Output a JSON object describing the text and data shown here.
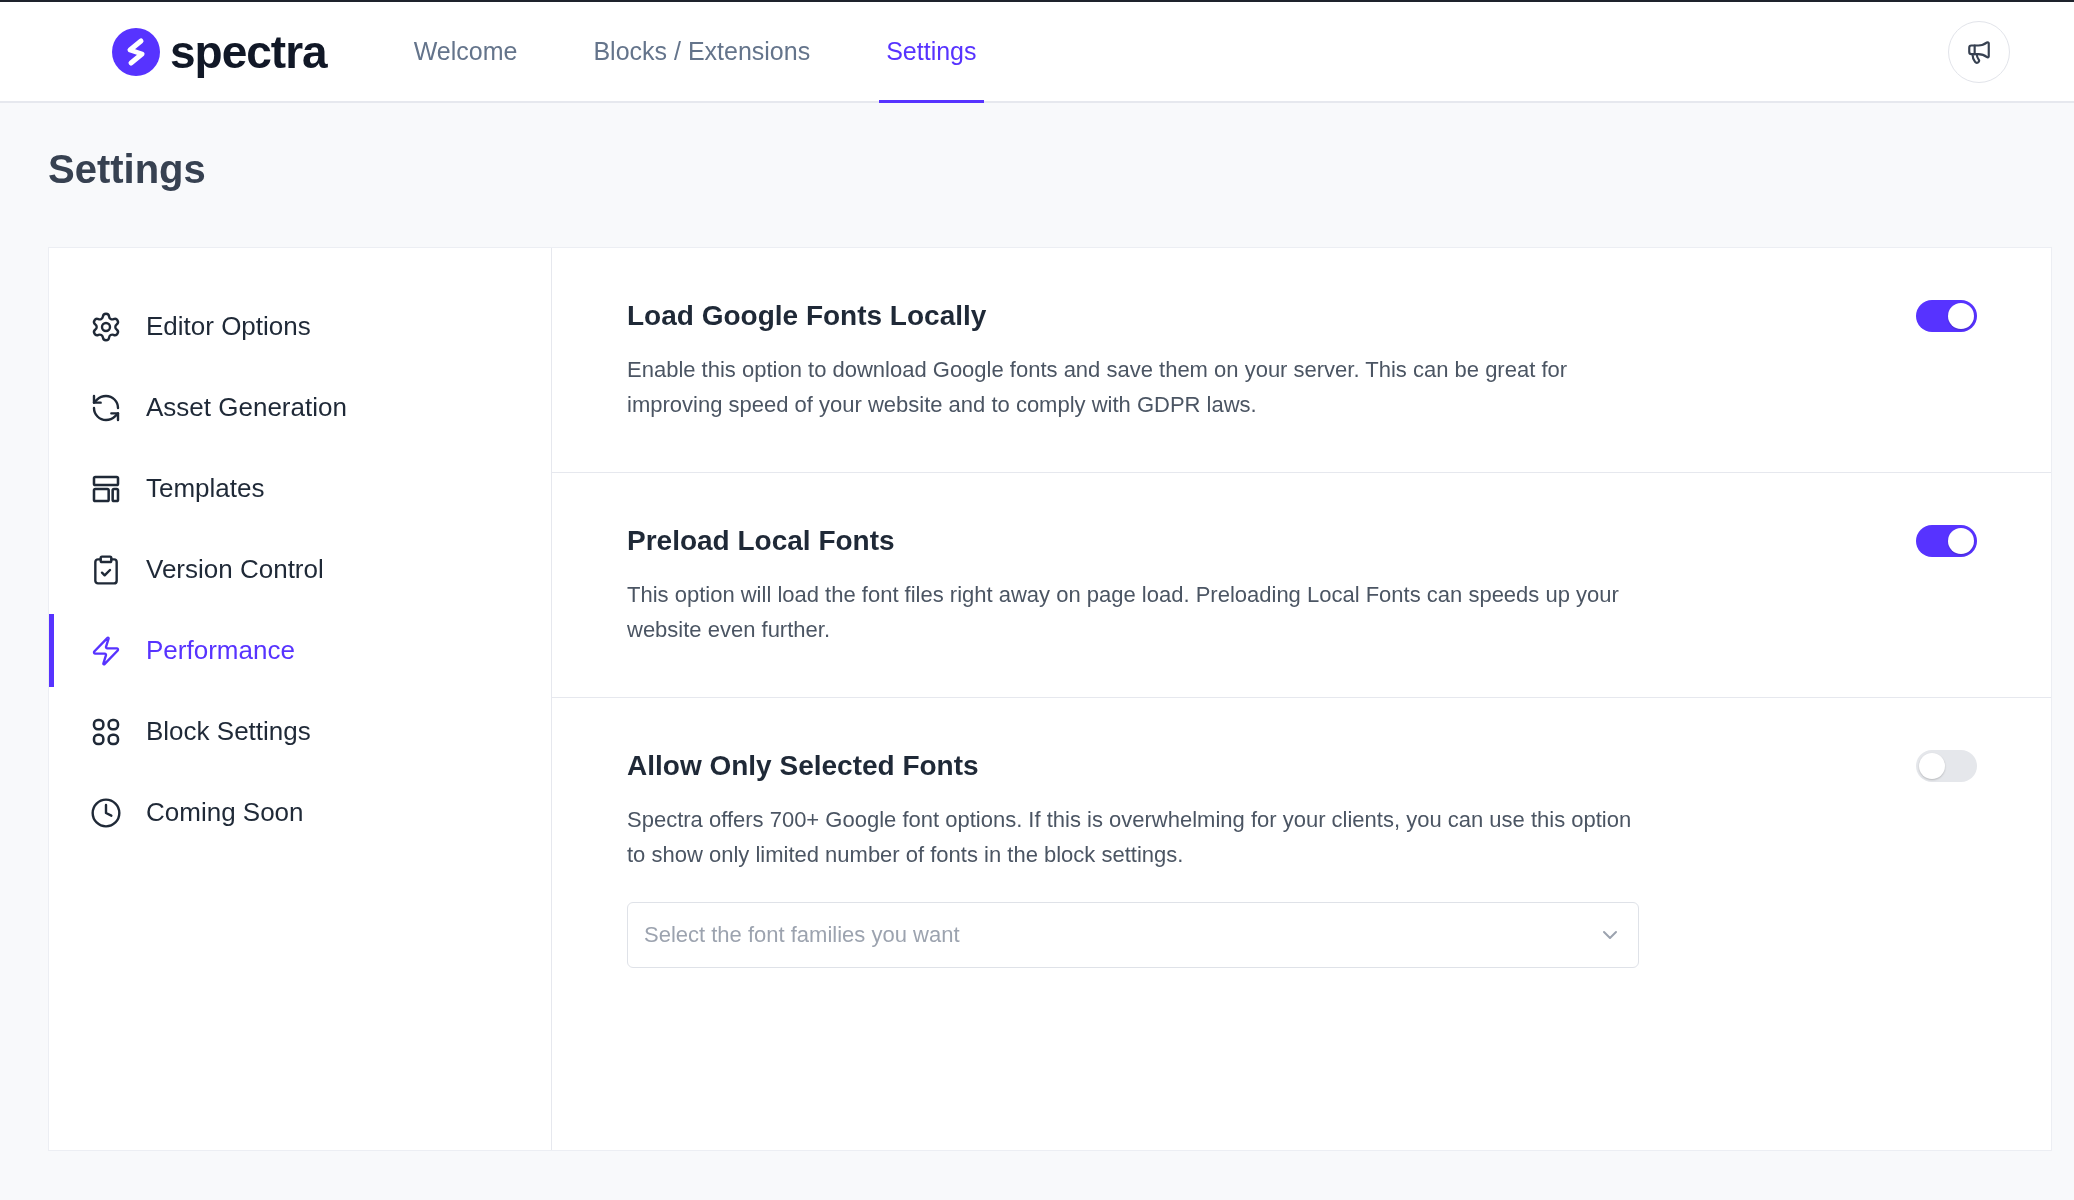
{
  "header": {
    "logo": "spectra",
    "nav": [
      {
        "label": "Welcome",
        "selected": false
      },
      {
        "label": "Blocks / Extensions",
        "selected": false
      },
      {
        "label": "Settings",
        "selected": true
      }
    ]
  },
  "page_title": "Settings",
  "sidebar": {
    "items": [
      {
        "label": "Editor Options",
        "selected": false
      },
      {
        "label": "Asset Generation",
        "selected": false
      },
      {
        "label": "Templates",
        "selected": false
      },
      {
        "label": "Version Control",
        "selected": false
      },
      {
        "label": "Performance",
        "selected": true
      },
      {
        "label": "Block Settings",
        "selected": false
      },
      {
        "label": "Coming Soon",
        "selected": false
      }
    ]
  },
  "settings": [
    {
      "title": "Load Google Fonts Locally",
      "description": "Enable this option to download Google fonts and save them on your server. This can be great for improving speed of your website and to comply with GDPR laws.",
      "on": true
    },
    {
      "title": "Preload Local Fonts",
      "description": "This option will load the font files right away on page load. Preloading Local Fonts can speeds up your website even further.",
      "on": true
    },
    {
      "title": "Allow Only Selected Fonts",
      "description": "Spectra offers 700+ Google font options. If this is overwhelming for your clients, you can use this option to show only limited number of fonts in the block settings.",
      "on": false,
      "select": {
        "placeholder": "Select the font families you want"
      }
    }
  ]
}
